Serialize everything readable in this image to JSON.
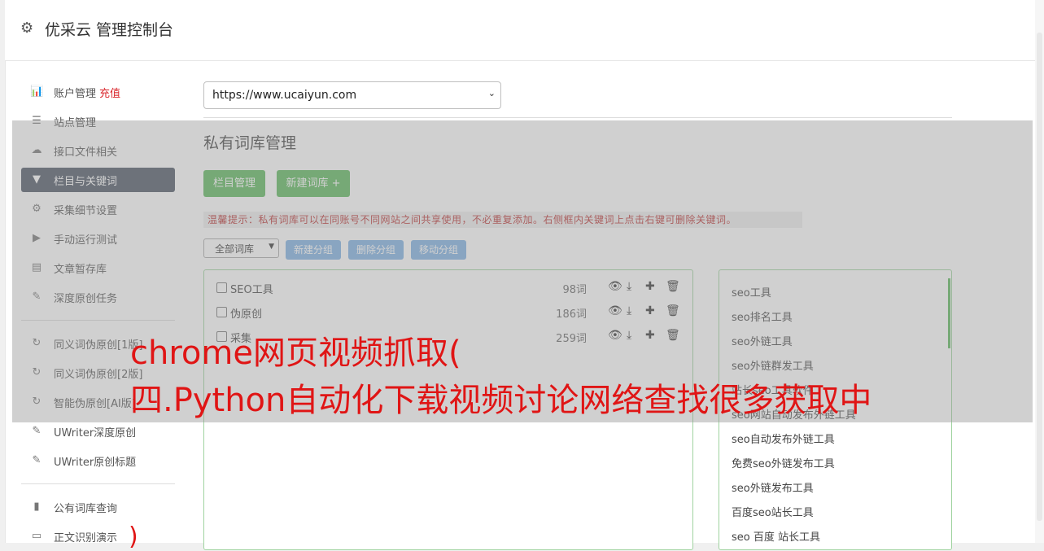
{
  "header": {
    "title": "优采云 管理控制台",
    "icon": "gear-icon"
  },
  "sidebar": {
    "items": [
      {
        "label": "账户管理",
        "icon": "bar-chart-icon",
        "badge": "充值"
      },
      {
        "label": "站点管理",
        "icon": "server-icon"
      },
      {
        "label": "接口文件相关",
        "icon": "cloud-upload-icon"
      },
      {
        "label": "栏目与关键词",
        "icon": "filter-icon",
        "active": true
      },
      {
        "label": "采集细节设置",
        "icon": "gears-icon"
      },
      {
        "label": "手动运行测试",
        "icon": "play-icon"
      },
      {
        "label": "文章暂存库",
        "icon": "database-icon"
      },
      {
        "label": "深度原创任务",
        "icon": "edit-icon"
      },
      {
        "label": "同义词伪原创[1版]",
        "icon": "refresh-icon"
      },
      {
        "label": "同义词伪原创[2版]",
        "icon": "refresh-icon"
      },
      {
        "label": "智能伪原创[AI版]",
        "icon": "refresh-icon"
      },
      {
        "label": "UWriter深度原创",
        "icon": "edit-icon"
      },
      {
        "label": "UWriter原创标题",
        "icon": "edit-icon"
      },
      {
        "label": "公有词库查询",
        "icon": "book-icon"
      },
      {
        "label": "正文识别演示",
        "icon": "monitor-icon"
      }
    ]
  },
  "site_select": {
    "value": "https://www.ucaiyun.com"
  },
  "main": {
    "title": "私有词库管理",
    "btn_columns": "栏目管理",
    "btn_new_lib": "新建词库 +",
    "tip": "温馨提示：私有词库可以在同账号不同网站之间共享使用，不必重复添加。右侧框内关键词上点击右键可删除关键词。",
    "lib_select": "全部词库",
    "btn_new_group": "新建分组",
    "btn_delete_group": "删除分组",
    "btn_move_group": "移动分组",
    "groups": [
      {
        "name": "SEO工具",
        "count": "98词"
      },
      {
        "name": "伪原创",
        "count": "186词"
      },
      {
        "name": "采集",
        "count": "259词"
      }
    ],
    "keywords": [
      "seo工具",
      "seo排名工具",
      "seo外链工具",
      "seo外链群发工具",
      "站长seo工具软件",
      "seo网站自动发布外链工具",
      "seo自动发布外链工具",
      "免费seo外链发布工具",
      "seo外链发布工具",
      "百度seo站长工具",
      "seo 百度 站长工具"
    ]
  },
  "watermark": {
    "line1": "chrome网页视频抓取(",
    "line2": "四.Python自动化下载视频讨论网络查找很多获取中",
    "paren": ")"
  },
  "colors": {
    "active_bg": "#4b5563",
    "green": "#5cb85c",
    "blue": "#7fb1e3",
    "red": "#e01515"
  }
}
